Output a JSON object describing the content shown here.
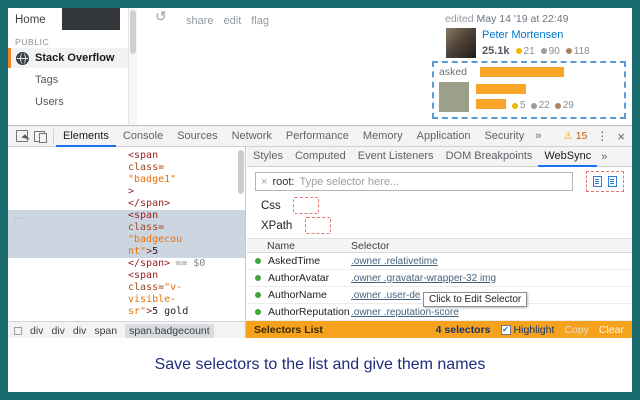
{
  "caption": "Save selectors to the list and give them names",
  "icons": {
    "refresh": "↺",
    "warning": "⚠",
    "kebab": "⋮",
    "close": "×",
    "chevrons": "»",
    "ellipsis": "…",
    "clear_input": "×",
    "check": "✔"
  },
  "colors": {
    "frame_teal": "#186a6c",
    "so_orange": "#f48024",
    "devtools_accent_blue": "#1a73e8",
    "highlight_orange": "#f9a528",
    "selectors_bar_orange": "#f6a21d",
    "badge_gold": "#f1b600",
    "badge_silver": "#9a9c9f",
    "badge_bronze": "#ab825f",
    "row_dot_green": "#3fa33f"
  },
  "so": {
    "sidebar": {
      "home": "Home",
      "section": "PUBLIC",
      "stack_overflow": "Stack Overflow",
      "tags": "Tags",
      "users": "Users"
    },
    "actions": {
      "share": "share",
      "edit": "edit",
      "flag": "flag"
    },
    "edited": {
      "label": "edited ",
      "date": "May 14 '19 at 22:49"
    },
    "editor": {
      "name": "Peter Mortensen",
      "reputation": "25.1k",
      "badges": [
        {
          "count": "21"
        },
        {
          "count": "90"
        },
        {
          "count": "118"
        }
      ]
    },
    "asked": {
      "label": "asked",
      "badges": [
        {
          "count": "5"
        },
        {
          "count": "22"
        },
        {
          "count": "29"
        }
      ]
    }
  },
  "devtools": {
    "tabs": [
      "Elements",
      "Console",
      "Sources",
      "Network",
      "Performance",
      "Memory",
      "Application",
      "Security"
    ],
    "warning_count": "15",
    "tree": {
      "l0": "<span",
      "l1": "class=",
      "l2": "\"badge1\"",
      "l3": ">",
      "l4": "</span>",
      "h0": "<span",
      "h1": "class=",
      "h2": "\"badgecou",
      "h3a": "nt\"",
      "h3b": ">",
      "h3c": "5",
      "c0": "</span>",
      "c1": "== $0",
      "m0": "<span",
      "m1a": "class=",
      "m1b": "\"v-",
      "m2": "visible-",
      "m3a": "sr\"",
      "m3b": ">",
      "m3c": "5 gold"
    },
    "breadcrumbs": [
      "div",
      "div",
      "div",
      "span",
      "span.badgecount"
    ],
    "sidebar_tabs": [
      "Styles",
      "Computed",
      "Event Listeners",
      "DOM Breakpoints",
      "WebSync"
    ],
    "websync": {
      "root_label": "root:",
      "selector_placeholder": "Type selector here...",
      "css_label": "Css",
      "xpath_label": "XPath",
      "table": {
        "headers": [
          "Name",
          "Selector"
        ],
        "rows": [
          {
            "name": "AskedTime",
            "selector": ".owner .relativetime"
          },
          {
            "name": "AuthorAvatar",
            "selector": ".owner .gravatar-wrapper-32 img"
          },
          {
            "name": "AuthorName",
            "selector": ".owner .user-de"
          },
          {
            "name": "AuthorReputation",
            "selector": ".owner .reputation-score"
          }
        ]
      },
      "tooltip": "Click to Edit Selector",
      "footer": {
        "title": "Selectors List",
        "count": "4 selectors",
        "highlight_label": "Highlight",
        "copy_label": "Copy",
        "clear_label": "Clear"
      }
    }
  }
}
